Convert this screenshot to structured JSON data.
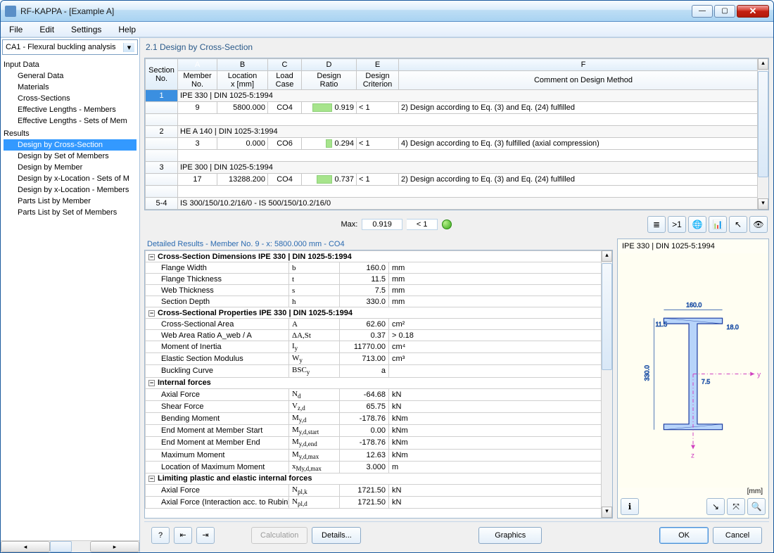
{
  "window": {
    "title": "RF-KAPPA - [Example A]"
  },
  "menubar": [
    "File",
    "Edit",
    "Settings",
    "Help"
  ],
  "sidebar": {
    "combo": "CA1 - Flexural buckling analysis",
    "groups": [
      {
        "label": "Input Data",
        "items": [
          "General Data",
          "Materials",
          "Cross-Sections",
          "Effective Lengths - Members",
          "Effective Lengths - Sets of Mem"
        ]
      },
      {
        "label": "Results",
        "items": [
          "Design by Cross-Section",
          "Design by Set of Members",
          "Design by Member",
          "Design by x-Location - Sets of M",
          "Design by x-Location - Members",
          "Parts List by Member",
          "Parts List by Set of Members"
        ]
      }
    ],
    "selected": "Design by Cross-Section"
  },
  "section_title": "2.1 Design by Cross-Section",
  "grid": {
    "col_letters": [
      "A",
      "B",
      "C",
      "D",
      "E",
      "F"
    ],
    "headers": {
      "sec": "Section No.",
      "a": "Member No.",
      "b": "Location x [mm]",
      "c": "Load Case",
      "d": "Design Ratio",
      "e": "Design Criterion",
      "f": "Comment on Design Method"
    },
    "rows": [
      {
        "type": "section",
        "sec": "1",
        "label": "IPE 330 | DIN 1025-5:1994",
        "sel": true
      },
      {
        "type": "data",
        "sec": "",
        "a": "9",
        "b": "5800.000",
        "c": "CO4",
        "d": "0.919",
        "e": "< 1",
        "f": "2) Design according to Eq. (3) and Eq. (24) fulfilled",
        "bar": 80
      },
      {
        "type": "blank"
      },
      {
        "type": "section",
        "sec": "2",
        "label": "HE A 140 | DIN 1025-3:1994"
      },
      {
        "type": "data",
        "sec": "",
        "a": "3",
        "b": "0.000",
        "c": "CO6",
        "d": "0.294",
        "e": "< 1",
        "f": "4) Design according to Eq. (3) fulfilled (axial compression)",
        "bar": 26
      },
      {
        "type": "blank"
      },
      {
        "type": "section",
        "sec": "3",
        "label": "IPE 300 | DIN 1025-5:1994"
      },
      {
        "type": "data",
        "sec": "",
        "a": "17",
        "b": "13288.200",
        "c": "CO4",
        "d": "0.737",
        "e": "< 1",
        "f": "2) Design according to Eq. (3) and Eq. (24) fulfilled",
        "bar": 64
      },
      {
        "type": "blank"
      },
      {
        "type": "section",
        "sec": "5-4",
        "label": "IS 300/150/10.2/16/0 - IS 500/150/10.2/16/0"
      }
    ]
  },
  "maxrow": {
    "label": "Max:",
    "val": "0.919",
    "crit": "< 1"
  },
  "detail": {
    "title": "Detailed Results  -  Member No.  9  -  x:  5800.000 mm  -  CO4",
    "rows": [
      {
        "g": "Cross-Section Dimensions IPE 330 | DIN 1025-5:1994"
      },
      {
        "n": "Flange Width",
        "s": "b",
        "v": "160.0",
        "u": "mm"
      },
      {
        "n": "Flange Thickness",
        "s": "t",
        "v": "11.5",
        "u": "mm"
      },
      {
        "n": "Web Thickness",
        "s": "s",
        "v": "7.5",
        "u": "mm"
      },
      {
        "n": "Section Depth",
        "s": "h",
        "v": "330.0",
        "u": "mm"
      },
      {
        "g": "Cross-Sectional Properties  IPE 330 | DIN 1025-5:1994"
      },
      {
        "n": "Cross-Sectional Area",
        "s": "A",
        "v": "62.60",
        "u": "cm²"
      },
      {
        "n": "Web Area Ratio A_web / A",
        "s": "ΔA,St",
        "v": "0.37",
        "u": "> 0.18"
      },
      {
        "n": "Moment of Inertia",
        "s": "I_y",
        "v": "11770.00",
        "u": "cm⁴"
      },
      {
        "n": "Elastic Section Modulus",
        "s": "W_y",
        "v": "713.00",
        "u": "cm³"
      },
      {
        "n": "Buckling Curve",
        "s": "BSC_y",
        "v": "a",
        "u": ""
      },
      {
        "g": "Internal forces"
      },
      {
        "n": "Axial Force",
        "s": "N_d",
        "v": "-64.68",
        "u": "kN"
      },
      {
        "n": "Shear Force",
        "s": "V_z,d",
        "v": "65.75",
        "u": "kN"
      },
      {
        "n": "Bending Moment",
        "s": "M_y,d",
        "v": "-178.76",
        "u": "kNm"
      },
      {
        "n": "End Moment at Member Start",
        "s": "M_y,d,start",
        "v": "0.00",
        "u": "kNm"
      },
      {
        "n": "End Moment at Member End",
        "s": "M_y,d,end",
        "v": "-178.76",
        "u": "kNm"
      },
      {
        "n": "Maximum Moment",
        "s": "M_y,d,max",
        "v": "12.63",
        "u": "kNm"
      },
      {
        "n": "Location of Maximum Moment",
        "s": "x_My,d,max",
        "v": "3.000",
        "u": "m"
      },
      {
        "g": "Limiting plastic and elastic internal forces"
      },
      {
        "n": "Axial Force",
        "s": "N_pl,k",
        "v": "1721.50",
        "u": "kN"
      },
      {
        "n": "Axial Force (Interaction acc. to Rubin)",
        "s": "N_pl,d",
        "v": "1721.50",
        "u": "kN"
      }
    ]
  },
  "profile": {
    "title": "IPE 330 | DIN 1025-5:1994",
    "unit": "[mm]",
    "dims": {
      "w": "160.0",
      "h": "330.0",
      "tf": "11.5",
      "tw": "7.5",
      "r": "18.0"
    }
  },
  "footer": {
    "calc": "Calculation",
    "details": "Details...",
    "graphics": "Graphics",
    "ok": "OK",
    "cancel": "Cancel"
  }
}
